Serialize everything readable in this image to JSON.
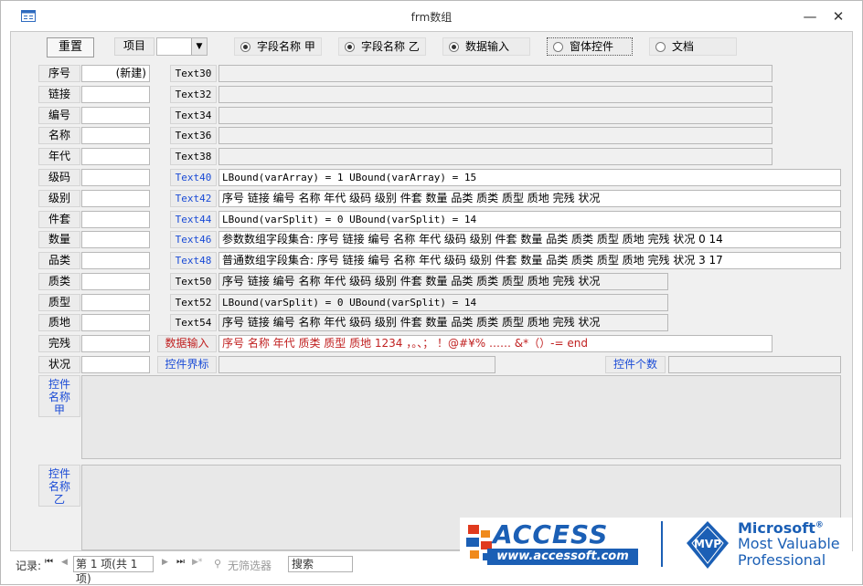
{
  "window": {
    "title": "frm数组",
    "minimize": "—",
    "close": "✕"
  },
  "toolbar": {
    "reset_label": "重置",
    "project_label": "项目",
    "combo_value": "",
    "options": [
      {
        "label": "字段名称 甲",
        "selected": true
      },
      {
        "label": "字段名称 乙",
        "selected": true
      },
      {
        "label": "数据输入",
        "selected": true
      },
      {
        "label": "窗体控件",
        "selected": false
      },
      {
        "label": "文档",
        "selected": false
      }
    ]
  },
  "fields": [
    {
      "label": "序号",
      "value": "(新建)",
      "tlabel": "Text30",
      "tvalue": ""
    },
    {
      "label": "链接",
      "value": "",
      "tlabel": "Text32",
      "tvalue": ""
    },
    {
      "label": "编号",
      "value": "",
      "tlabel": "Text34",
      "tvalue": ""
    },
    {
      "label": "名称",
      "value": "",
      "tlabel": "Text36",
      "tvalue": ""
    },
    {
      "label": "年代",
      "value": "",
      "tlabel": "Text38",
      "tvalue": ""
    },
    {
      "label": "级码",
      "value": "",
      "tlabel": "Text40",
      "tvalue": "LBound(varArray) = 1  UBound(varArray) = 15"
    },
    {
      "label": "级别",
      "value": "",
      "tlabel": "Text42",
      "tvalue": "序号 链接 编号 名称 年代 级码 级别 件套 数量 品类 质类    质型 质地 完残 状况"
    },
    {
      "label": "件套",
      "value": "",
      "tlabel": "Text44",
      "tvalue": "LBound(varSplit) = 0  UBound(varSplit) = 14"
    },
    {
      "label": "数量",
      "value": "",
      "tlabel": "Text46",
      "tvalue": "参数数组字段集合: 序号 链接 编号 名称 年代 级码 级别 件套 数量 品类 质类 质型 质地 完残 状况     0  14"
    },
    {
      "label": "品类",
      "value": "",
      "tlabel": "Text48",
      "tvalue": "普通数组字段集合: 序号 链接 编号 名称 年代 级码 级别 件套 数量 品类 质类 质型 质地 完残 状况     3  17"
    },
    {
      "label": "质类",
      "value": "",
      "tlabel": "Text50",
      "tvalue": "序号 链接 编号 名称 年代 级码 级别 件套 数量 品类 质类 质型 质地 完残 状况"
    },
    {
      "label": "质型",
      "value": "",
      "tlabel": "Text52",
      "tvalue": "LBound(varSplit) = 0  UBound(varSplit) = 14"
    },
    {
      "label": "质地",
      "value": "",
      "tlabel": "Text54",
      "tvalue": "序号 链接 编号 名称 年代 级码 级别 件套 数量 品类 质类 质型 质地 完残 状况"
    },
    {
      "label": "完残",
      "value": "",
      "tlabel": "数据输入",
      "tvalue": "序号 名称 年代 质类 质型 质地 1234 ，。、；  ！@#¥% …… &*（）-= end"
    },
    {
      "label": "状况",
      "value": "",
      "tlabel": "控件界标",
      "tvalue": ""
    }
  ],
  "control_count_label": "控件个数",
  "control_count_value": "",
  "memo": {
    "a_label": "控件名称甲",
    "b_label": "控件名称乙"
  },
  "nav": {
    "record_label": "记录:",
    "first": "⏮",
    "prev": "◀",
    "position": "第 1 项(共 1 项)",
    "next": "▶",
    "last": "⏭",
    "new": "▶*",
    "filter": "无筛选器",
    "search": "搜索"
  },
  "logo": {
    "access": "ACCESS",
    "site": "www.accessoft.com",
    "mvp": "MVP",
    "ms": "Microsoft",
    "ms_mark": "®",
    "line1": "Most Valuable",
    "line2": "Professional"
  },
  "colors": {
    "blue_label": "#1a4bd6",
    "red_text": "#c02020",
    "form_bg": "#f0f0f0"
  }
}
